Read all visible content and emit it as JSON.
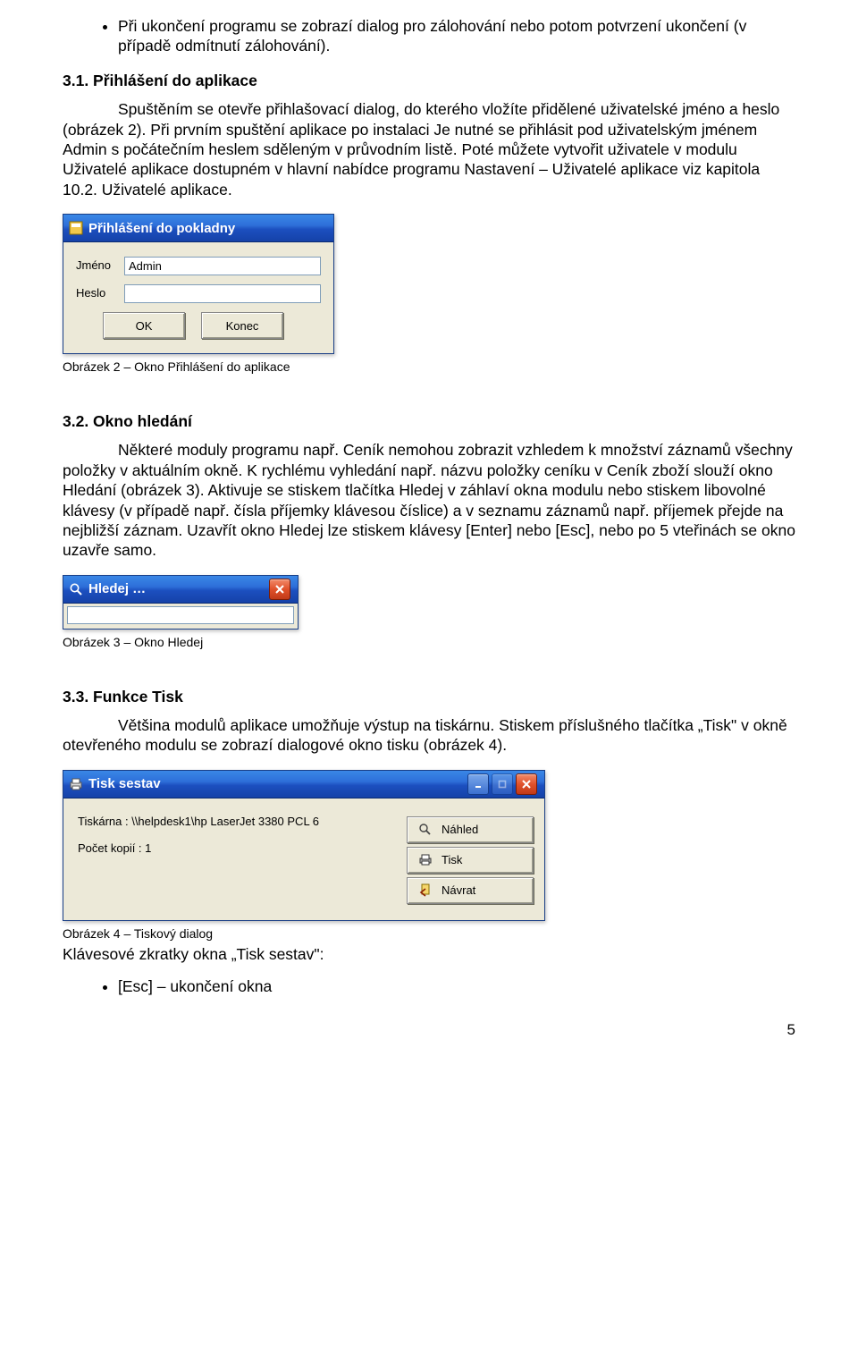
{
  "bullets_top": [
    "Při ukončení programu se zobrazí dialog pro zálohování nebo potom potvrzení ukončení (v případě odmítnutí zálohování)."
  ],
  "section31": {
    "heading": "3.1. Přihlášení do aplikace",
    "text": "Spuštěním se otevře přihlašovací dialog, do kterého vložíte přidělené uživatelské jméno a heslo (obrázek 2). Při prvním spuštění aplikace po instalaci Je nutné se přihlásit pod uživatelským jménem Admin s počátečním heslem sděleným v průvodním listě. Poté můžete vytvořit uživatele v modulu Uživatelé aplikace dostupném v hlavní nabídce programu Nastavení – Uživatelé aplikace viz kapitola 10.2. Uživatelé aplikace.",
    "caption": "Obrázek 2 – Okno Přihlášení do aplikace"
  },
  "login_dialog": {
    "title": "Přihlášení do pokladny",
    "label_name": "Jméno",
    "label_pass": "Heslo",
    "value_name": "Admin",
    "value_pass": "",
    "btn_ok": "OK",
    "btn_konec": "Konec"
  },
  "section32": {
    "heading": "3.2. Okno hledání",
    "text": "Některé moduly programu např. Ceník nemohou zobrazit vzhledem k množství záznamů všechny položky v aktuálním okně. K rychlému vyhledání např. názvu položky ceníku v Ceník zboží slouží okno Hledání (obrázek 3). Aktivuje se stiskem tlačítka Hledej v záhlaví okna modulu nebo stiskem libovolné klávesy (v případě např. čísla příjemky klávesou číslice) a v seznamu záznamů např. příjemek přejde na nejbližší záznam. Uzavřít okno Hledej lze stiskem klávesy [Enter] nebo [Esc], nebo po 5 vteřinách se okno uzavře samo.",
    "caption": "Obrázek 3 – Okno Hledej"
  },
  "hledej_dialog": {
    "title": "Hledej …",
    "value": ""
  },
  "section33": {
    "heading": "3.3. Funkce Tisk",
    "text": "Většina modulů aplikace umožňuje výstup na tiskárnu. Stiskem příslušného tlačítka „Tisk\" v okně otevřeného modulu se zobrazí dialogové okno tisku (obrázek 4).",
    "caption": "Obrázek 4 – Tiskový dialog",
    "aftercap": "Klávesové zkratky okna „Tisk sestav\":"
  },
  "tisk_dialog": {
    "title": "Tisk sestav",
    "printer_line": "Tiskárna :  \\\\helpdesk1\\hp LaserJet 3380 PCL 6",
    "copies_line": "Počet kopií :  1",
    "btn_nahled": "Náhled",
    "btn_tisk": "Tisk",
    "btn_navrat": "Návrat"
  },
  "bullets_bottom": [
    "[Esc] – ukončení okna"
  ],
  "page_number": "5"
}
